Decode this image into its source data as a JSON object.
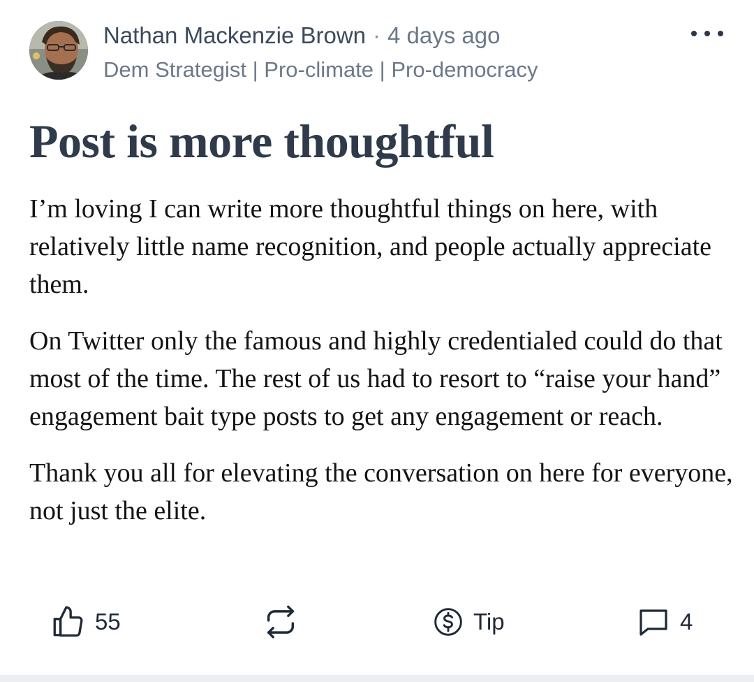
{
  "post": {
    "author": {
      "name": "Nathan Mackenzie Brown",
      "separator": "·",
      "timestamp": "4 days ago",
      "tagline": "Dem Strategist | Pro-climate | Pro-democracy"
    },
    "title": "Post is more thoughtful",
    "paragraphs": [
      "I’m loving I can write more thoughtful things on here, with relatively little name recognition, and people actually appreciate them.",
      "On Twitter only the famous and highly credentialed could do that most of the time. The rest of us had to resort to “raise your hand” engagement bait type posts to get any engagement or reach.",
      "Thank you all for elevating the conversation on here for everyone, not just the elite."
    ],
    "actions": {
      "like": {
        "icon": "thumbs-up-icon",
        "count": "55"
      },
      "restack": {
        "icon": "restack-icon"
      },
      "tip": {
        "icon": "dollar-circle-icon",
        "label": "Tip"
      },
      "comment": {
        "icon": "comment-icon",
        "count": "4"
      }
    },
    "menu_icon": "more-horizontal-icon"
  },
  "colors": {
    "title": "#2f3a4a",
    "author": "#3b4a5c",
    "meta": "#6b7889",
    "body_text": "#141414",
    "icon": "#1f2937"
  }
}
